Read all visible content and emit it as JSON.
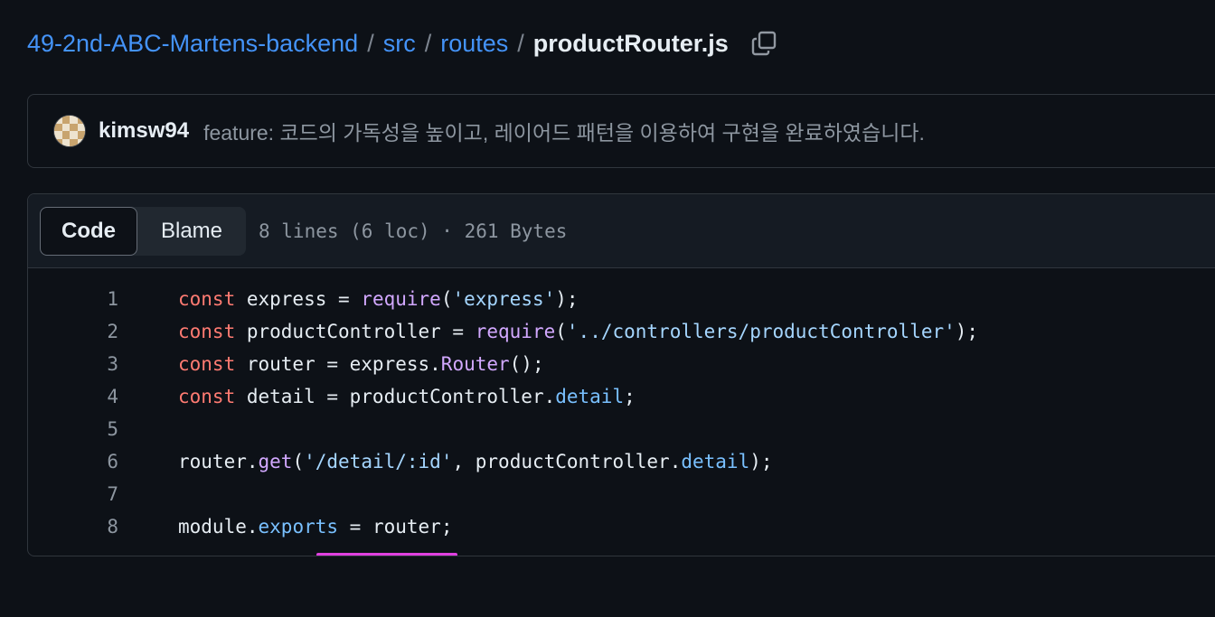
{
  "breadcrumb": {
    "repo": "49-2nd-ABC-Martens-backend",
    "separator": "/",
    "dir1": "src",
    "dir2": "routes",
    "file": "productRouter.js",
    "copy_icon": "copy-icon"
  },
  "commit": {
    "author": "kimsw94",
    "message": "feature: 코드의 가독성을 높이고, 레이어드 패턴을 이용하여 구현을 완료하였습니다."
  },
  "file": {
    "tabs": [
      "Code",
      "Blame"
    ],
    "active_tab": "Code",
    "meta": "8 lines (6 loc) · 261 Bytes",
    "lines": [
      {
        "num": "1",
        "tokens": [
          {
            "t": "const",
            "c": "kw"
          },
          {
            "t": " express = ",
            "c": ""
          },
          {
            "t": "require",
            "c": "fn"
          },
          {
            "t": "(",
            "c": ""
          },
          {
            "t": "'express'",
            "c": "str"
          },
          {
            "t": ");",
            "c": ""
          }
        ]
      },
      {
        "num": "2",
        "tokens": [
          {
            "t": "const",
            "c": "kw"
          },
          {
            "t": " productController = ",
            "c": ""
          },
          {
            "t": "require",
            "c": "fn"
          },
          {
            "t": "(",
            "c": ""
          },
          {
            "t": "'../controllers/productController'",
            "c": "str"
          },
          {
            "t": ");",
            "c": ""
          }
        ]
      },
      {
        "num": "3",
        "tokens": [
          {
            "t": "const",
            "c": "kw"
          },
          {
            "t": " router = express.",
            "c": ""
          },
          {
            "t": "Router",
            "c": "fn"
          },
          {
            "t": "();",
            "c": ""
          }
        ]
      },
      {
        "num": "4",
        "tokens": [
          {
            "t": "const",
            "c": "kw"
          },
          {
            "t": " detail = productController.",
            "c": ""
          },
          {
            "t": "detail",
            "c": "prop"
          },
          {
            "t": ";",
            "c": ""
          }
        ]
      },
      {
        "num": "5",
        "tokens": []
      },
      {
        "num": "6",
        "tokens": [
          {
            "t": "router.",
            "c": ""
          },
          {
            "t": "get",
            "c": "fn"
          },
          {
            "t": "(",
            "c": ""
          },
          {
            "t": "'/detail/:id'",
            "c": "str"
          },
          {
            "t": ", productController.",
            "c": ""
          },
          {
            "t": "detail",
            "c": "prop"
          },
          {
            "t": ");",
            "c": ""
          }
        ]
      },
      {
        "num": "7",
        "tokens": []
      },
      {
        "num": "8",
        "tokens": [
          {
            "t": "module.",
            "c": ""
          },
          {
            "t": "exports",
            "c": "prop"
          },
          {
            "t": " = router;",
            "c": ""
          }
        ]
      }
    ]
  },
  "colors": {
    "keyword": "#ff7b72",
    "function": "#d2a8ff",
    "string": "#a5d6ff",
    "property": "#79c0ff",
    "annotation_underline": "#e040e0"
  }
}
